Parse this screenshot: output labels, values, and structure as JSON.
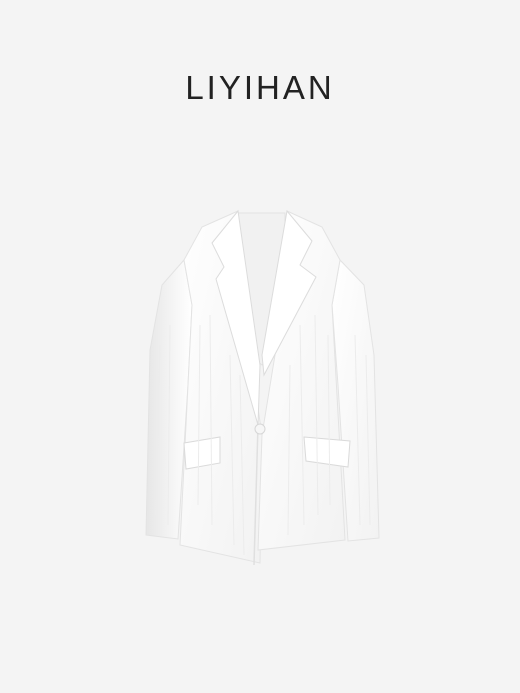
{
  "brand": {
    "name": "LIYIHAN"
  },
  "product": {
    "type": "white single-button blazer",
    "color": "#ffffff"
  },
  "colors": {
    "background": "#f4f4f4",
    "text": "#222222"
  }
}
